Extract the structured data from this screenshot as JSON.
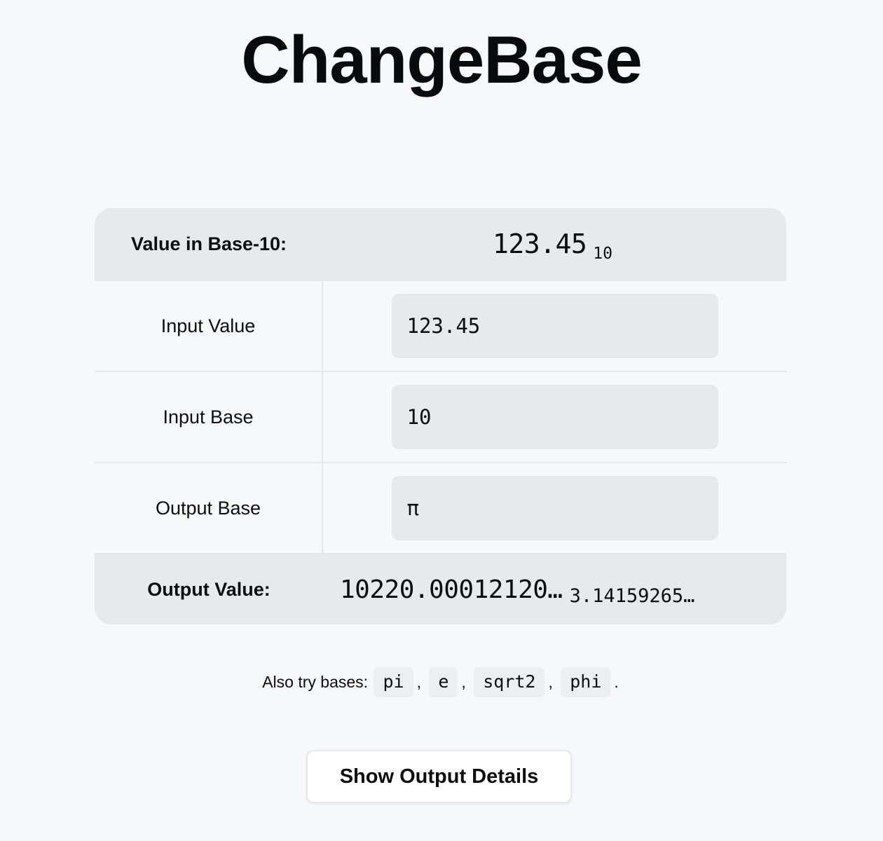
{
  "app": {
    "title": "ChangeBase"
  },
  "summary_header": {
    "label": "Value in Base-10:",
    "value": "123.45",
    "subscript": "10"
  },
  "fields": [
    {
      "label": "Input Value",
      "value": "123.45",
      "placeholder": "",
      "name": "input-value"
    },
    {
      "label": "Input Base",
      "value": "10",
      "placeholder": "",
      "name": "input-base"
    },
    {
      "label": "Output Base",
      "value": "π",
      "placeholder": "",
      "name": "output-base"
    }
  ],
  "summary_footer": {
    "label": "Output Value:",
    "value": "10220.00012120…",
    "subscript": "3.14159265…"
  },
  "also_try": {
    "intro": "Also try bases:",
    "bases": [
      "pi",
      "e",
      "sqrt2",
      "phi"
    ],
    "separator": ",",
    "terminator": "."
  },
  "actions": {
    "details_button": "Show Output Details"
  },
  "colors": {
    "page_background": "#f7f8fa",
    "summary_row_background": "#e7eaed",
    "field_background": "#e7eaed",
    "border": "#e4e8ec",
    "text": "#0b0d0e",
    "button_background": "#ffffff"
  }
}
